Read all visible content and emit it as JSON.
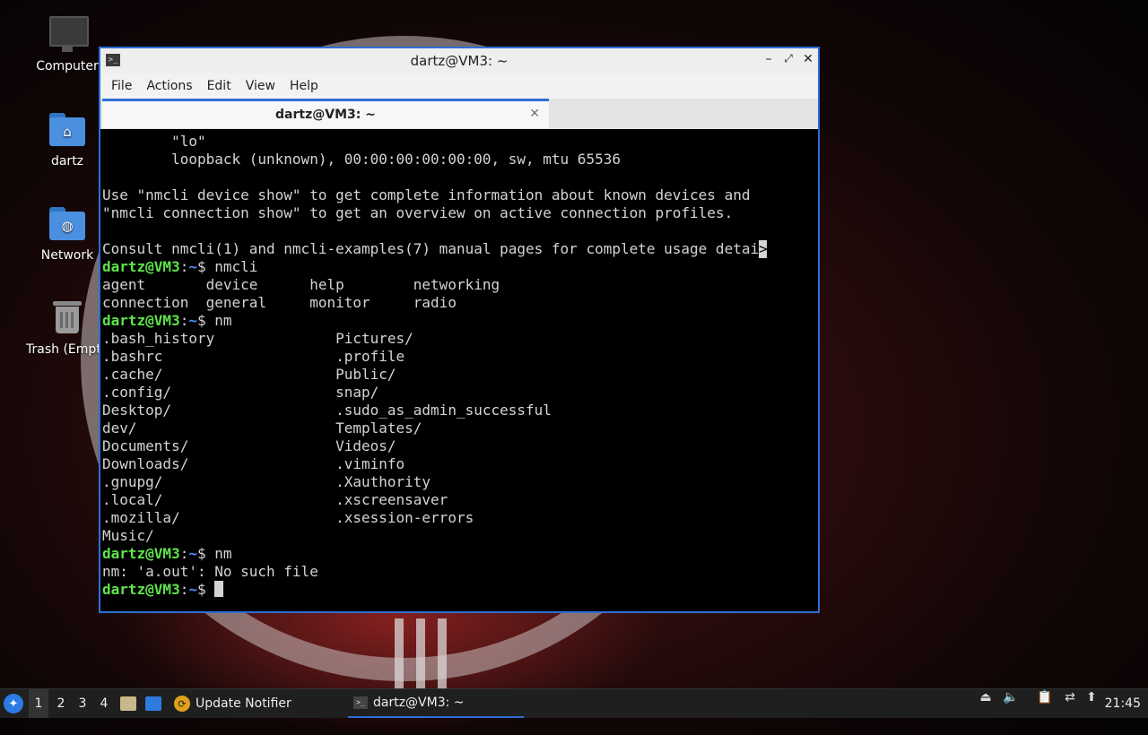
{
  "desktop": {
    "icons": [
      {
        "label": "Computer",
        "icon": "monitor-icon"
      },
      {
        "label": "dartz",
        "icon": "home-folder-icon"
      },
      {
        "label": "Network",
        "icon": "network-folder-icon"
      },
      {
        "label": "Trash (Empty)",
        "icon": "trash-icon"
      }
    ]
  },
  "window": {
    "title": "dartz@VM3: ~",
    "controls": {
      "minimize": "–",
      "maximize": "⤢",
      "close": "✕"
    },
    "menu": [
      "File",
      "Actions",
      "Edit",
      "View",
      "Help"
    ],
    "tab": {
      "label": "dartz@VM3: ~",
      "close": "✕"
    }
  },
  "terminal": {
    "prompt": {
      "user": "dartz@VM3",
      "sep": ":",
      "path": "~",
      "dollar": "$ "
    },
    "lines": [
      {
        "type": "text",
        "text": "        \"lo\""
      },
      {
        "type": "text",
        "text": "        loopback (unknown), 00:00:00:00:00:00, sw, mtu 65536"
      },
      {
        "type": "text",
        "text": ""
      },
      {
        "type": "text",
        "text": "Use \"nmcli device show\" to get complete information about known devices and"
      },
      {
        "type": "text",
        "text": "\"nmcli connection show\" to get an overview on active connection profiles."
      },
      {
        "type": "text",
        "text": ""
      },
      {
        "type": "text",
        "text": "Consult nmcli(1) and nmcli-examples(7) manual pages for complete usage detai"
      },
      {
        "type": "prompt",
        "cmd": "nmcli"
      },
      {
        "type": "text",
        "text": "agent       device      help        networking"
      },
      {
        "type": "text",
        "text": "connection  general     monitor     radio"
      },
      {
        "type": "prompt",
        "cmd": "nm"
      },
      {
        "type": "text",
        "text": ".bash_history              Pictures/"
      },
      {
        "type": "text",
        "text": ".bashrc                    .profile"
      },
      {
        "type": "text",
        "text": ".cache/                    Public/"
      },
      {
        "type": "text",
        "text": ".config/                   snap/"
      },
      {
        "type": "text",
        "text": "Desktop/                   .sudo_as_admin_successful"
      },
      {
        "type": "text",
        "text": "dev/                       Templates/"
      },
      {
        "type": "text",
        "text": "Documents/                 Videos/"
      },
      {
        "type": "text",
        "text": "Downloads/                 .viminfo"
      },
      {
        "type": "text",
        "text": ".gnupg/                    .Xauthority"
      },
      {
        "type": "text",
        "text": ".local/                    .xscreensaver"
      },
      {
        "type": "text",
        "text": ".mozilla/                  .xsession-errors"
      },
      {
        "type": "text",
        "text": "Music/"
      },
      {
        "type": "prompt",
        "cmd": "nm"
      },
      {
        "type": "text",
        "text": "nm: 'a.out': No such file"
      },
      {
        "type": "prompt",
        "cmd": "",
        "cursor": true
      }
    ],
    "overflow_marker": ">"
  },
  "taskbar": {
    "start": "✦",
    "workspaces": [
      "1",
      "2",
      "3",
      "4"
    ],
    "active_workspace": "1",
    "tasks": [
      {
        "label": "Update Notifier",
        "icon": "update-notifier-icon"
      },
      {
        "label": "dartz@VM3: ~",
        "icon": "terminal-icon"
      }
    ],
    "clock": "21:45"
  }
}
